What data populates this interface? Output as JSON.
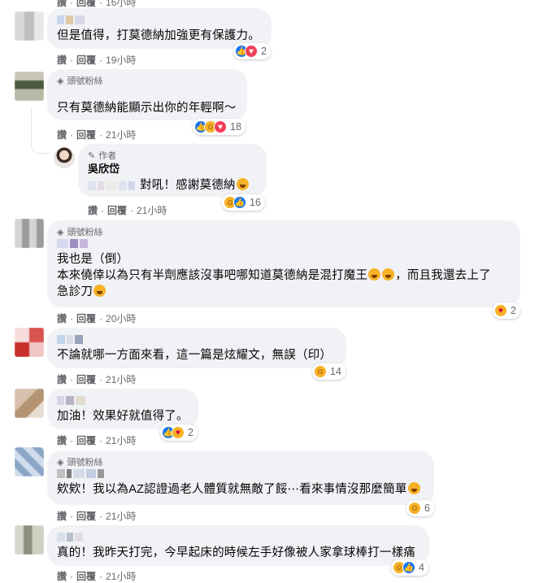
{
  "top_partial": {
    "actions": [
      "讚",
      "回覆",
      "16小時"
    ]
  },
  "labels": {
    "like": "讚",
    "reply": "回覆",
    "top_fan": "頭號粉絲",
    "author": "作者"
  },
  "comments": [
    {
      "text": "但是值得，打莫德納加強更有保護力。",
      "time": "19小時",
      "react_count": "2"
    },
    {
      "badge": "頭號粉絲",
      "text": "只有莫德納能顯示出你的年輕啊～",
      "time": "21小時",
      "react_count": "18"
    },
    {
      "badge": "作者",
      "author_name": "吳欣岱",
      "text": "對吼！感謝莫德納",
      "time": "21小時",
      "react_count": "16"
    },
    {
      "badge": "頭號粉絲",
      "line1": "我也是（倒）",
      "line2": "本來僥倖以為只有半劑應該沒事吧哪知道莫德納是混打魔王",
      "line2b": "，而且我還去上了",
      "line3": "急診刀",
      "time": "20小時",
      "react_count": "2"
    },
    {
      "text": "不論就哪一方面來看，這一篇是炫耀文，無誤（印）",
      "time": "21小時",
      "react_count": "14"
    },
    {
      "text": "加油！效果好就值得了。",
      "time": "21小時",
      "react_count": "2"
    },
    {
      "badge": "頭號粉絲",
      "text": "欸欸！我以為AZ認證過老人體質就無敵了餒⋯看來事情沒那麼簡單",
      "time": "21小時",
      "react_count": "6"
    },
    {
      "text": "真的！我昨天打完，今早起床的時候左手好像被人家拿球棒打一樣痛",
      "time": "21小時",
      "react_count": "4"
    }
  ],
  "colors": {
    "bubble": "#f0f2f5",
    "meta": "#65676b",
    "like_blue": "#1877f2",
    "love_red": "#f33e58",
    "haha_yellow": "#f7b125"
  }
}
